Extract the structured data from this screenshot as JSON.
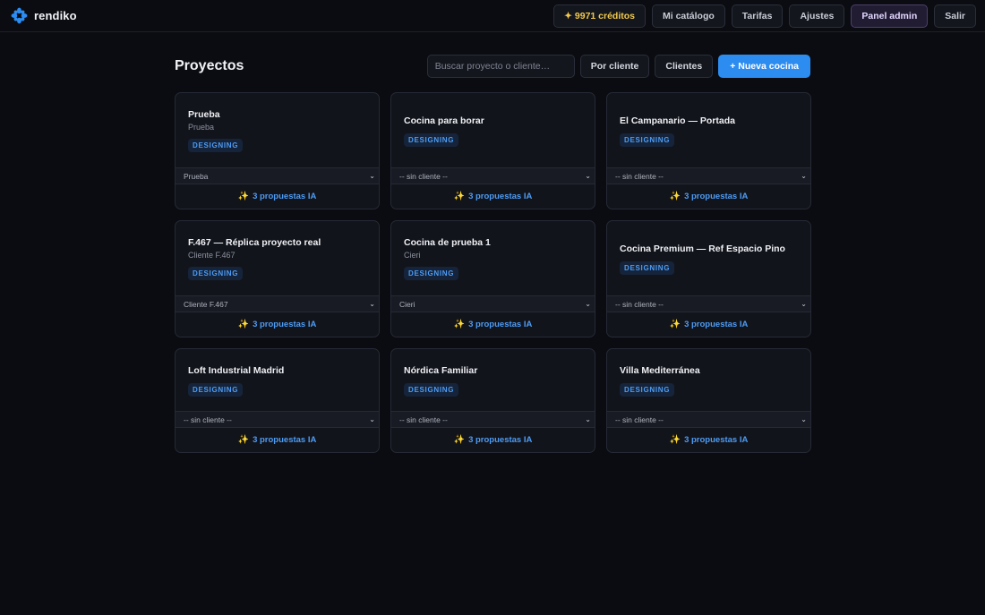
{
  "brand": {
    "name": "rendiko",
    "accent": "#2d8cf0"
  },
  "nav": {
    "credits": "✦ 9971 créditos",
    "catalog": "Mi catálogo",
    "pricing": "Tarifas",
    "settings": "Ajustes",
    "admin": "Panel admin",
    "logout": "Salir"
  },
  "page": {
    "title": "Proyectos"
  },
  "toolbar": {
    "search_placeholder": "Buscar proyecto o cliente…",
    "by_client": "Por cliente",
    "clients": "Clientes",
    "new_kitchen": "+ Nueva cocina"
  },
  "projects": [
    {
      "title": "Prueba",
      "client": "Prueba",
      "status": "DESIGNING",
      "select": "Prueba",
      "proposals": "3 propuestas IA"
    },
    {
      "title": "Cocina para borar",
      "client": "",
      "status": "DESIGNING",
      "select": "-- sin cliente --",
      "proposals": "3 propuestas IA"
    },
    {
      "title": "El Campanario — Portada",
      "client": "",
      "status": "DESIGNING",
      "select": "-- sin cliente --",
      "proposals": "3 propuestas IA"
    },
    {
      "title": "F.467 — Réplica proyecto real",
      "client": "Cliente F.467",
      "status": "DESIGNING",
      "select": "Cliente F.467",
      "proposals": "3 propuestas IA"
    },
    {
      "title": "Cocina de prueba 1",
      "client": "Cieri",
      "status": "DESIGNING",
      "select": "Cieri",
      "proposals": "3 propuestas IA"
    },
    {
      "title": "Cocina Premium — Ref Espacio Pino",
      "client": "",
      "status": "DESIGNING",
      "select": "-- sin cliente --",
      "proposals": "3 propuestas IA"
    },
    {
      "title": "Loft Industrial Madrid",
      "client": "",
      "status": "DESIGNING",
      "select": "-- sin cliente --",
      "proposals": "3 propuestas IA"
    },
    {
      "title": "Nórdica Familiar",
      "client": "",
      "status": "DESIGNING",
      "select": "-- sin cliente --",
      "proposals": "3 propuestas IA"
    },
    {
      "title": "Villa Mediterránea",
      "client": "",
      "status": "DESIGNING",
      "select": "-- sin cliente --",
      "proposals": "3 propuestas IA"
    }
  ]
}
